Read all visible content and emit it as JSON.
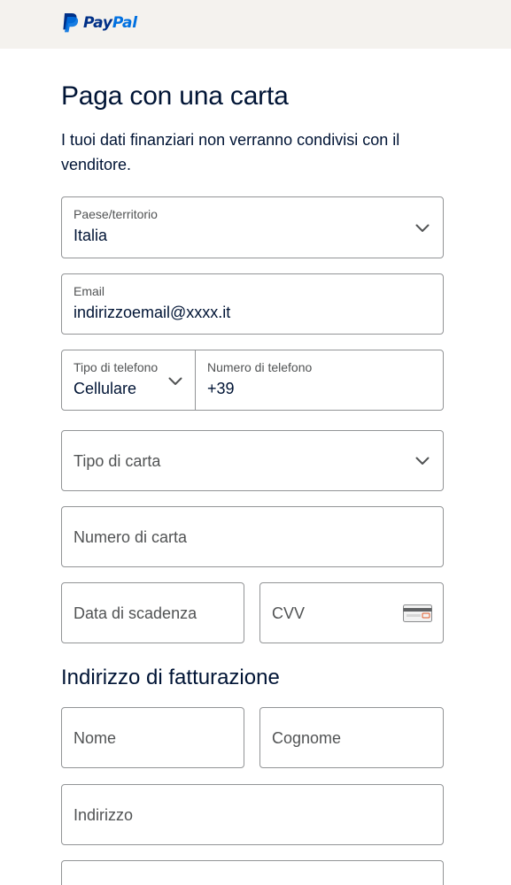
{
  "brand": {
    "name_part1": "Pay",
    "name_part2": "Pal",
    "color_dark": "#003087",
    "color_light": "#0070e0"
  },
  "page": {
    "title": "Paga con una carta",
    "subtitle": "I tuoi dati finanziari non verranno condivisi con il venditore."
  },
  "form": {
    "country": {
      "label": "Paese/territorio",
      "value": "Italia",
      "icon": "chevron-down-icon"
    },
    "email": {
      "label": "Email",
      "value": "indirizzoemail@xxxx.it"
    },
    "phone_type": {
      "label": "Tipo di telefono",
      "value": "Cellulare",
      "icon": "chevron-down-icon"
    },
    "phone_number": {
      "label": "Numero di telefono",
      "value": "+39"
    },
    "card_type": {
      "placeholder": "Tipo di carta",
      "icon": "chevron-down-icon"
    },
    "card_number": {
      "placeholder": "Numero di carta"
    },
    "expiry": {
      "placeholder": "Data di scadenza"
    },
    "cvv": {
      "placeholder": "CVV",
      "icon": "card-cvv-icon"
    }
  },
  "billing": {
    "heading": "Indirizzo di fatturazione",
    "first_name": {
      "placeholder": "Nome"
    },
    "last_name": {
      "placeholder": "Cognome"
    },
    "address": {
      "placeholder": "Indirizzo"
    }
  }
}
